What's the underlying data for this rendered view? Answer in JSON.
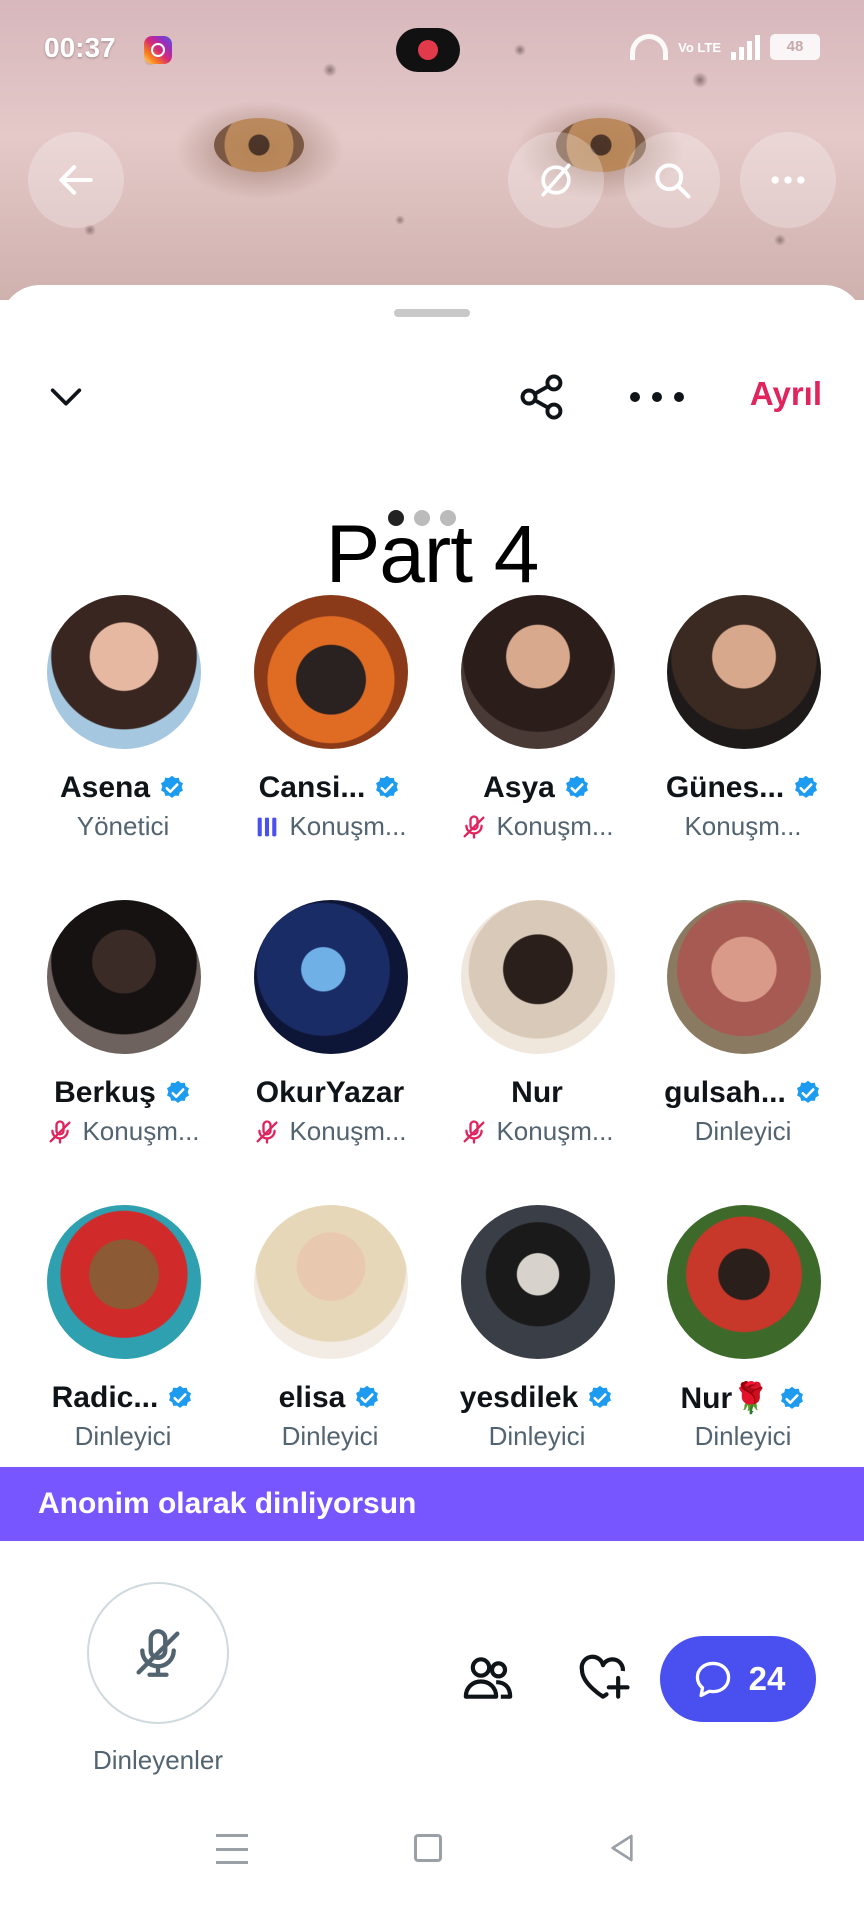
{
  "status_bar": {
    "time": "00:37",
    "network": "Vo LTE",
    "battery": "48",
    "icons": [
      "instagram-icon",
      "record-icon",
      "wifi-icon",
      "signal-icon",
      "battery-icon"
    ]
  },
  "hero": {
    "buttons": [
      "back-arrow-icon",
      "no-translate-icon",
      "search-icon",
      "more-icon"
    ]
  },
  "header": {
    "leave_label": "Ayrıl",
    "icons": [
      "chevron-down-icon",
      "share-icon",
      "more-icon"
    ]
  },
  "overlay_text": "Part 4",
  "participants": [
    {
      "name": "Asena",
      "verified": true,
      "role": "Yönetici",
      "state": "none"
    },
    {
      "name": "Cansi...",
      "verified": true,
      "role": "Konuşm...",
      "state": "speaking"
    },
    {
      "name": "Asya",
      "verified": true,
      "role": "Konuşm...",
      "state": "muted"
    },
    {
      "name": "Günes...",
      "verified": true,
      "role": "Konuşm...",
      "state": "none"
    },
    {
      "name": "Berkuş",
      "verified": true,
      "role": "Konuşm...",
      "state": "muted"
    },
    {
      "name": "OkurYazar",
      "verified": false,
      "role": "Konuşm...",
      "state": "muted"
    },
    {
      "name": "Nur",
      "verified": false,
      "role": "Konuşm...",
      "state": "muted"
    },
    {
      "name": "gulsah...",
      "verified": true,
      "role": "Dinleyici",
      "state": "none"
    },
    {
      "name": "Radic...",
      "verified": true,
      "role": "Dinleyici",
      "state": "none"
    },
    {
      "name": "elisa",
      "verified": true,
      "role": "Dinleyici",
      "state": "none"
    },
    {
      "name": "yesdilek",
      "verified": true,
      "role": "Dinleyici",
      "state": "none"
    },
    {
      "name": "Nur🌹",
      "verified": true,
      "role": "Dinleyici",
      "state": "none"
    }
  ],
  "anon_banner": "Anonim olarak dinliyorsun",
  "controls": {
    "mic_label": "Dinleyenler",
    "chat_count": "24",
    "icons": [
      "mic-off-icon",
      "people-icon",
      "heart-plus-icon",
      "chat-bubble-icon"
    ]
  },
  "colors": {
    "accent_purple": "#7856ff",
    "chat_button": "#4a4ff0",
    "leave_red": "#e0245e",
    "verified_blue": "#1d9bf0",
    "muted_red": "#e0245e"
  }
}
